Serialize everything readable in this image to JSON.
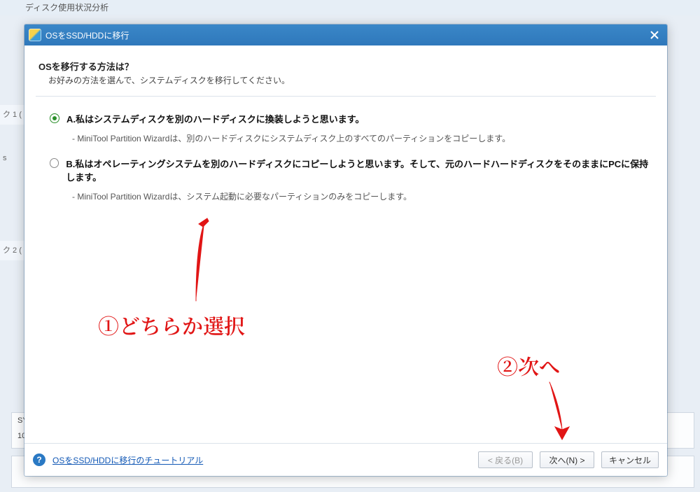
{
  "background": {
    "tabstrip_text": "ディスク使用状況分析",
    "side_disk1": "ク 1 (",
    "side_disk2": "ク 2 (",
    "side_label_s": "s",
    "bottom_sys": "SY",
    "bottom_num": "10"
  },
  "modal": {
    "title": "OSをSSD/HDDに移行",
    "heading": "OSを移行する方法は？",
    "subheading": "お好みの方法を選んで、システムディスクを移行してください。",
    "options": [
      {
        "label": "A.私はシステムディスクを別のハードディスクに換装しようと思います。",
        "desc": "- MiniTool Partition Wizardは、別のハードディスクにシステムディスク上のすべてのパーティションをコピーします。",
        "selected": true
      },
      {
        "label": "B.私はオペレーティングシステムを別のハードディスクにコピーしようと思います。そして、元のハードハードディスクをそのままにPCに保持します。",
        "desc": "- MiniTool Partition Wizardは、システム起動に必要なパーティションのみをコピーします。",
        "selected": false
      }
    ],
    "footer": {
      "tutorial_link": "OSをSSD/HDDに移行のチュートリアル",
      "back_label": "< 戻る(B)",
      "next_label": "次へ(N) >",
      "cancel_label": "キャンセル"
    }
  },
  "annotations": {
    "step1": "①どちらか選択",
    "step2": "②次へ"
  }
}
